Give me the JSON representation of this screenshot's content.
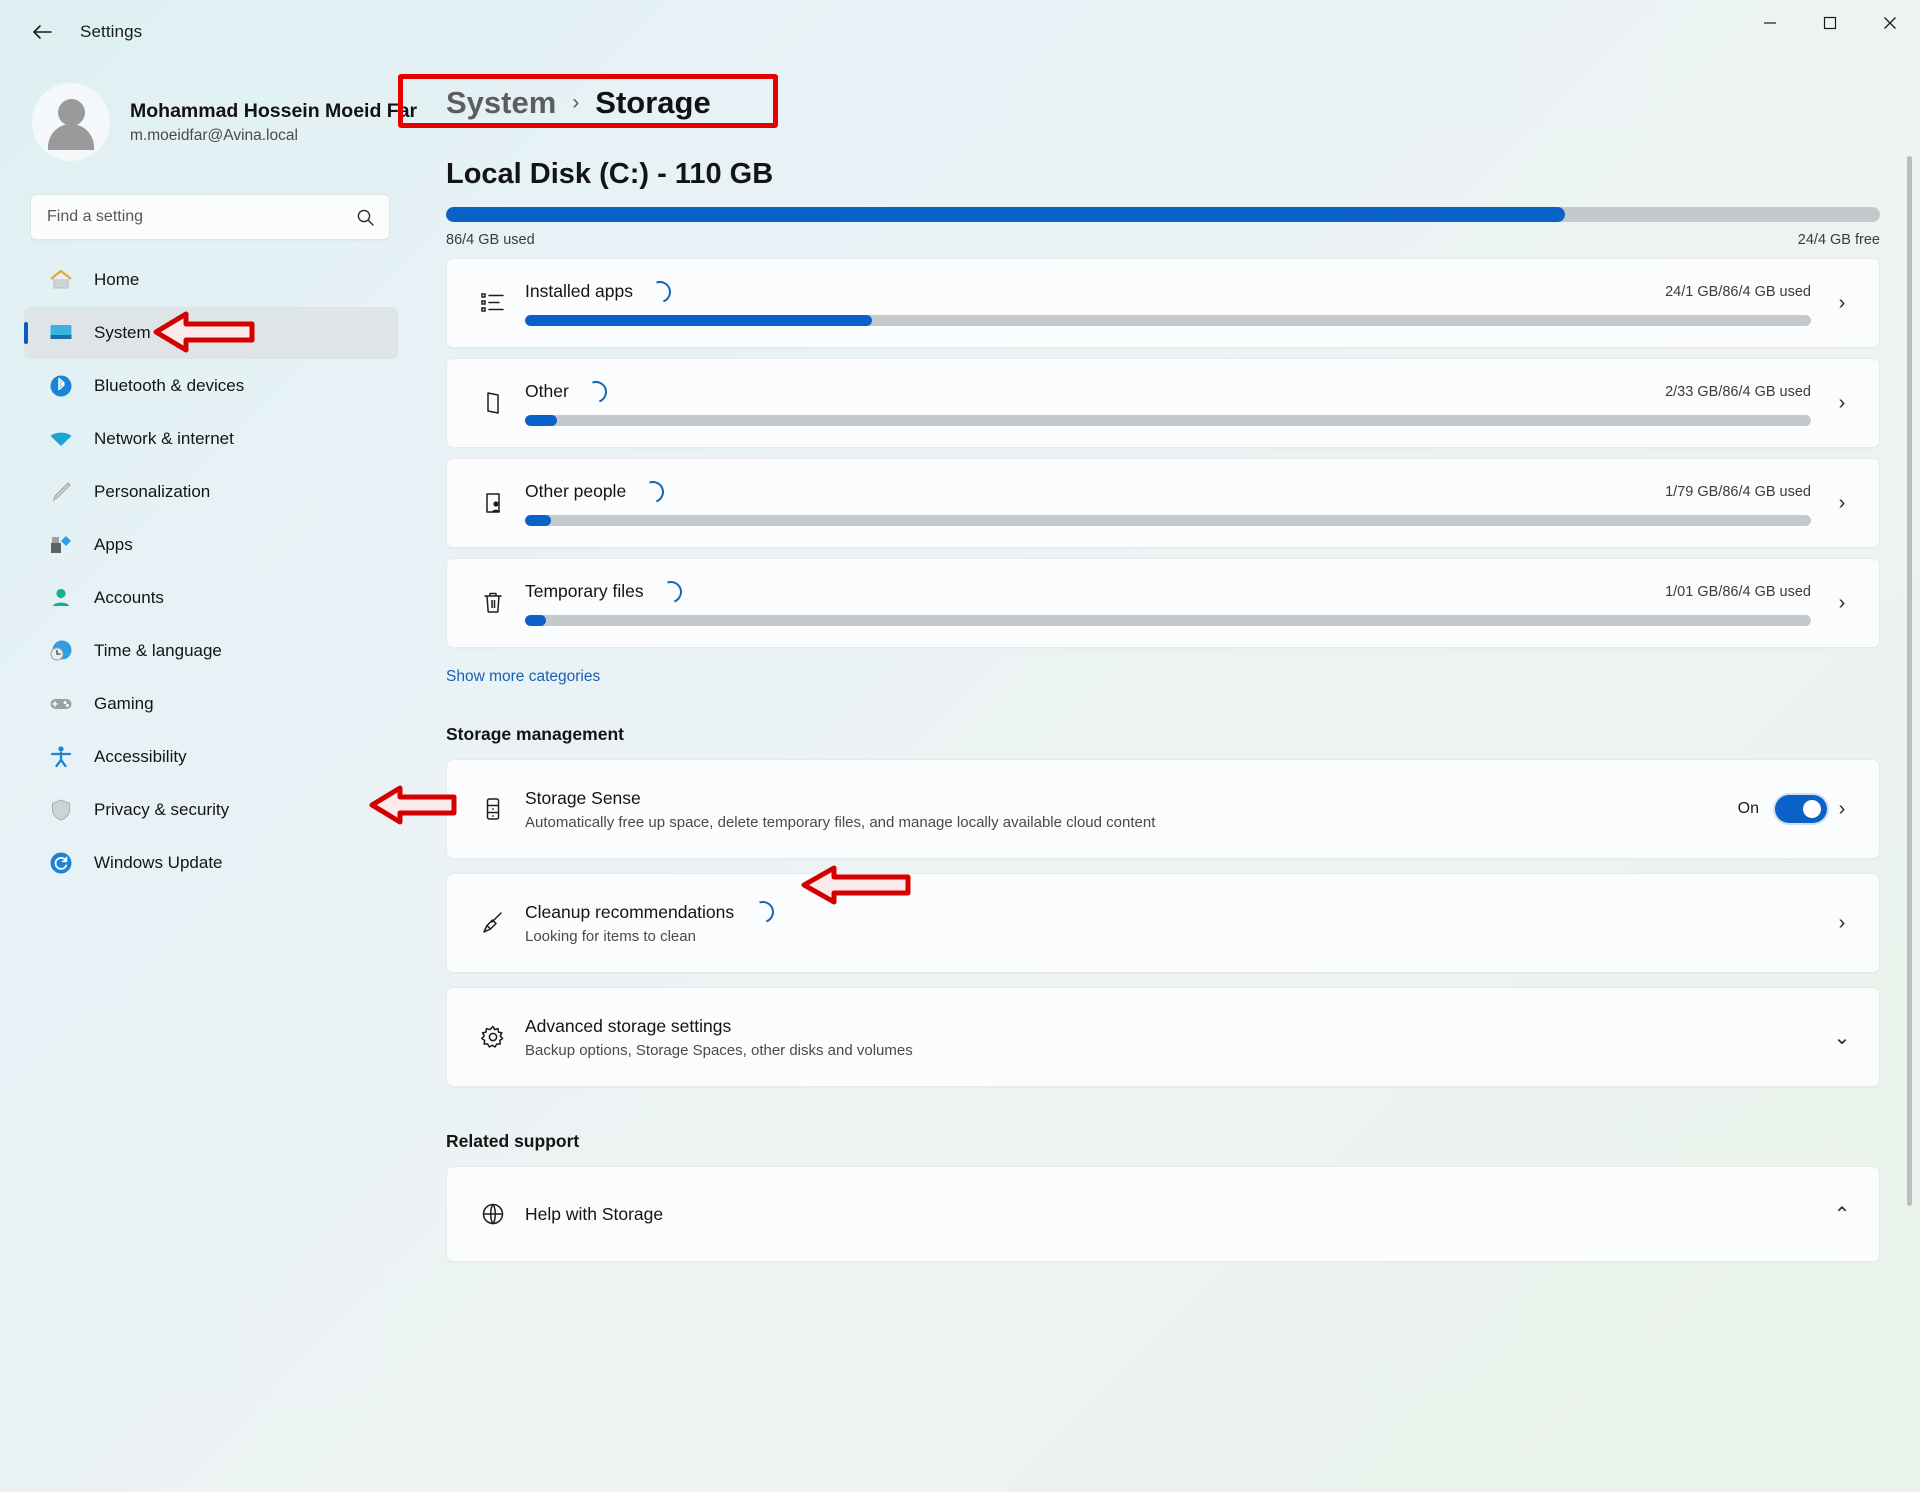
{
  "window": {
    "title": "Settings",
    "back_icon": "back-arrow-icon",
    "minimize_label": "─",
    "maximize_label": "☐",
    "close_label": "✕"
  },
  "account": {
    "name": "Mohammad Hossein Moeid Far",
    "email": "m.moeidfar@Avina.local",
    "avatar_icon": "user-avatar-icon"
  },
  "search": {
    "placeholder": "Find a setting",
    "value": "",
    "icon": "search-icon"
  },
  "sidebar": {
    "items": [
      {
        "label": "Home",
        "icon": "home-icon",
        "active": false
      },
      {
        "label": "System",
        "icon": "system-icon",
        "active": true
      },
      {
        "label": "Bluetooth & devices",
        "icon": "bluetooth-icon",
        "active": false
      },
      {
        "label": "Network & internet",
        "icon": "network-icon",
        "active": false
      },
      {
        "label": "Personalization",
        "icon": "personalization-brush-icon",
        "active": false
      },
      {
        "label": "Apps",
        "icon": "apps-icon",
        "active": false
      },
      {
        "label": "Accounts",
        "icon": "accounts-person-icon",
        "active": false
      },
      {
        "label": "Time & language",
        "icon": "time-language-clock-icon",
        "active": false
      },
      {
        "label": "Gaming",
        "icon": "gaming-controller-icon",
        "active": false
      },
      {
        "label": "Accessibility",
        "icon": "accessibility-person-icon",
        "active": false
      },
      {
        "label": "Privacy & security",
        "icon": "shield-icon",
        "active": false
      },
      {
        "label": "Windows Update",
        "icon": "windows-update-refresh-icon",
        "active": false
      }
    ]
  },
  "breadcrumb": {
    "parent": "System",
    "separator": "›",
    "current": "Storage"
  },
  "disk": {
    "title": "Local Disk (C:) - 110 GB",
    "used_label": "86/4 GB used",
    "free_label": "24/4 GB free",
    "used_percent": 78
  },
  "categories": [
    {
      "name": "Installed apps",
      "icon": "installed-apps-list-icon",
      "usage": "24/1 GB/86/4 GB used",
      "percent": 27,
      "loading": true,
      "chevron": "›"
    },
    {
      "name": "Other",
      "icon": "other-file-icon",
      "usage": "2/33 GB/86/4 GB used",
      "percent": 2.5,
      "loading": true,
      "chevron": "›"
    },
    {
      "name": "Other people",
      "icon": "other-people-icon",
      "usage": "1/79 GB/86/4 GB used",
      "percent": 2,
      "loading": true,
      "chevron": "›"
    },
    {
      "name": "Temporary files",
      "icon": "temporary-files-trash-icon",
      "usage": "1/01 GB/86/4 GB used",
      "percent": 1.6,
      "loading": true,
      "chevron": "›"
    }
  ],
  "show_more": "Show more categories",
  "management": {
    "section_title": "Storage management",
    "storage_sense": {
      "title": "Storage Sense",
      "subtitle": "Automatically free up space, delete temporary files, and manage locally available cloud content",
      "icon": "storage-sense-drive-icon",
      "toggle_label": "On",
      "toggle_on": true,
      "chevron": "›"
    },
    "cleanup": {
      "title": "Cleanup recommendations",
      "subtitle": "Looking for items to clean",
      "icon": "cleanup-broom-icon",
      "loading": true,
      "chevron": "›"
    },
    "advanced": {
      "title": "Advanced storage settings",
      "subtitle": "Backup options, Storage Spaces, other disks and volumes",
      "icon": "gear-icon",
      "chevron": "⌄"
    }
  },
  "related": {
    "section_title": "Related support",
    "help": {
      "label": "Help with Storage",
      "icon": "help-globe-icon",
      "chevron": "⌃"
    }
  },
  "colors": {
    "accent": "#0a62c9",
    "annotation": "#e60000",
    "link": "#1a5fb4",
    "track": "#c6c9cb"
  }
}
